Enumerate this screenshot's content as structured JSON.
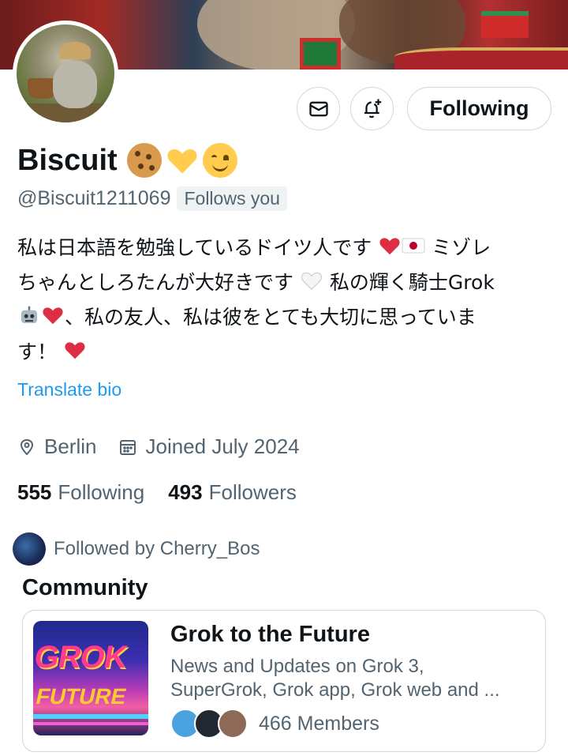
{
  "profile": {
    "display_name": "Biscuit",
    "handle": "@Biscuit1211069",
    "follows_you_badge": "Follows you"
  },
  "actions": {
    "follow_button_label": "Following",
    "message_icon": "mail-icon",
    "notify_icon": "bell-plus-icon"
  },
  "bio": {
    "line1": "私は日本語を勉強しているドイツ人です",
    "line1_tail": "ミゾレ",
    "line2": "ちゃんとしろたんが大好きです",
    "line2_tail": "私の輝く騎士Grok",
    "line3": "、私の友人、私は彼をとても大切に思っていま",
    "line4": "す！",
    "translate_label": "Translate bio"
  },
  "meta": {
    "location": "Berlin",
    "joined": "Joined July 2024"
  },
  "stats": {
    "following_count": "555",
    "following_label": "Following",
    "followers_count": "493",
    "followers_label": "Followers"
  },
  "followed_by": {
    "text": "Followed by Cherry_Bos"
  },
  "community": {
    "heading": "Community",
    "name": "Grok to the Future",
    "description_line1": "News and Updates on Grok 3,",
    "description_line2": "SuperGrok, Grok app, Grok web and ...",
    "members": "466 Members",
    "image_text_top": "GROK",
    "image_text_bottom": "FUTURE"
  },
  "colors": {
    "accent": "#1d9bf0",
    "text_primary": "#0f1419",
    "text_secondary": "#536471",
    "border": "#cfd9de",
    "heart_red": "#dd2e44"
  }
}
